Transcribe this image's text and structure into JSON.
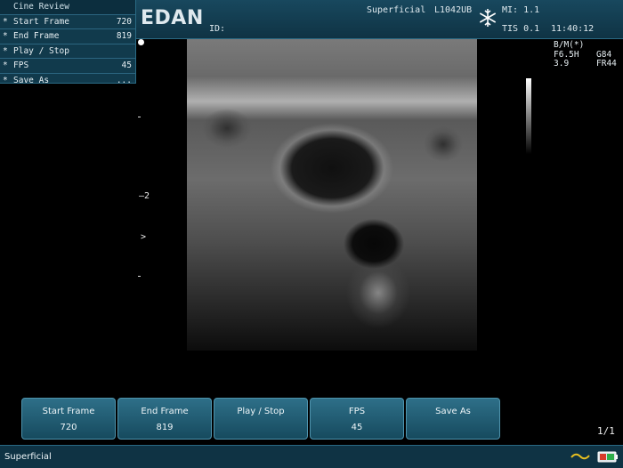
{
  "header": {
    "logo": "EDAN",
    "id_label": "ID:",
    "preset": "Superficial",
    "probe": "L1042UB",
    "mi": "MI: 1.1",
    "tis": "TIS 0.1",
    "time": "11:40:12"
  },
  "menu": {
    "title": "Cine Review",
    "items": [
      {
        "label": "Start Frame",
        "value": "720"
      },
      {
        "label": "End Frame",
        "value": "819"
      },
      {
        "label": "Play / Stop",
        "value": ""
      },
      {
        "label": "FPS",
        "value": "45"
      },
      {
        "label": "Save As",
        "value": "..."
      }
    ],
    "marker": "*"
  },
  "image": {
    "depth_mark": "—2",
    "focus_mark": ">"
  },
  "params": {
    "mode": "B/M(*)",
    "freq": "F6.5H",
    "gain": "G84",
    "depth": "3.9",
    "frame_rate": "FR44"
  },
  "softkeys": [
    {
      "title": "Start Frame",
      "value": "720"
    },
    {
      "title": "End Frame",
      "value": "819"
    },
    {
      "title": "Play / Stop",
      "value": ""
    },
    {
      "title": "FPS",
      "value": "45"
    },
    {
      "title": "Save As",
      "value": ""
    }
  ],
  "page_indicator": "1/1",
  "status": {
    "preset": "Superficial"
  },
  "colors": {
    "panel": "#113a4c",
    "accent": "#2e6f88",
    "wave": "#e8c020"
  }
}
